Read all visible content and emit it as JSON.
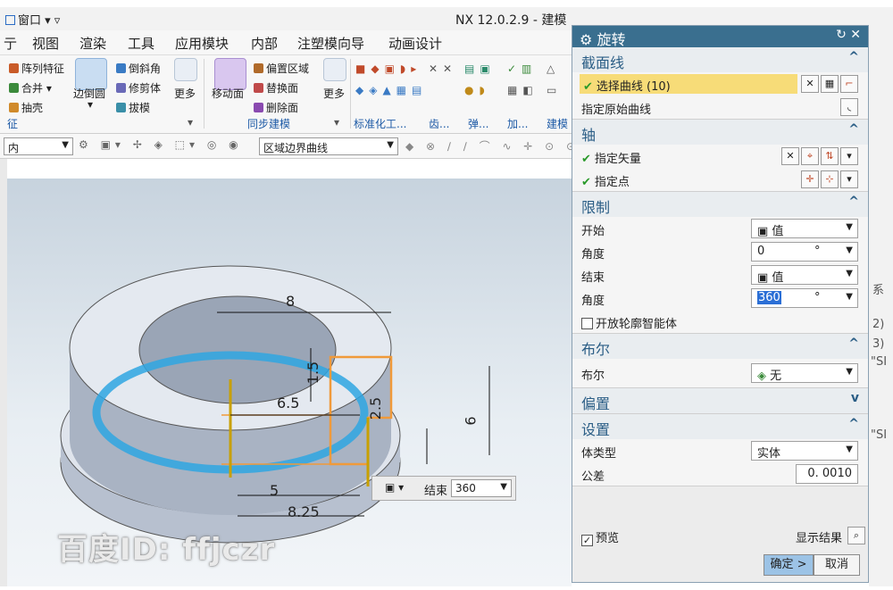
{
  "app": {
    "window_menu": "窗口",
    "title": "NX 12.0.2.9 - 建模"
  },
  "menubar": [
    "亍",
    "视图",
    "渲染",
    "工具",
    "应用模块",
    "内部",
    "注塑模向导",
    "动画设计"
  ],
  "ribbon": {
    "items": {
      "array_feature": "阵列特征",
      "unite": "合并",
      "shell": "抽壳",
      "edge_blend": "边倒圆",
      "chamfer": "倒斜角",
      "trim_body": "修剪体",
      "draft": "拔模",
      "more1": "更多",
      "move_face": "移动面",
      "offset_region": "偏置区域",
      "replace_face": "替换面",
      "delete_face": "删除面",
      "more2": "更多"
    },
    "groups": {
      "g1": "征",
      "sync": "同步建模",
      "standard": "标准化工...",
      "gear": "齿...",
      "spring": "弹...",
      "add": "加...",
      "build": "建模"
    }
  },
  "toolbar2": {
    "left_combo": "内",
    "curve_rule_combo": "区域边界曲线"
  },
  "viewport": {
    "dims": [
      "8",
      "6.5",
      "1.5",
      "6",
      "2.5",
      "5",
      "8.25"
    ],
    "float_control": {
      "label": "结束",
      "value": "360"
    },
    "watermark": "百度ID: ffjczr"
  },
  "dialog": {
    "title": "旋转",
    "sections": {
      "section_curve": {
        "title": "截面线",
        "select_curve": "选择曲线 (10)",
        "specify_origin_curve": "指定原始曲线"
      },
      "axis": {
        "title": "轴",
        "specify_vector": "指定矢量",
        "specify_point": "指定点"
      },
      "limits": {
        "title": "限制",
        "start_label": "开始",
        "start_value": "值",
        "angle_label": "角度",
        "start_angle": "0",
        "end_label": "结束",
        "end_value": "值",
        "end_angle": "360",
        "unit": "°",
        "open_profile": "开放轮廓智能体"
      },
      "boolean": {
        "title": "布尔",
        "label": "布尔",
        "value": "无"
      },
      "offset": {
        "title": "偏置"
      },
      "settings": {
        "title": "设置",
        "body_type_label": "体类型",
        "body_type_value": "实体",
        "tolerance_label": "公差",
        "tolerance_value": "0. 0010"
      }
    },
    "preview_label": "预览",
    "show_result": "显示结果",
    "ok": "确定 >",
    "cancel": "取消"
  },
  "right_peek": {
    "label1": "系",
    "label2": "2)",
    "label3": "3)",
    "label4": "\"SI",
    "label5": "\"SI"
  }
}
